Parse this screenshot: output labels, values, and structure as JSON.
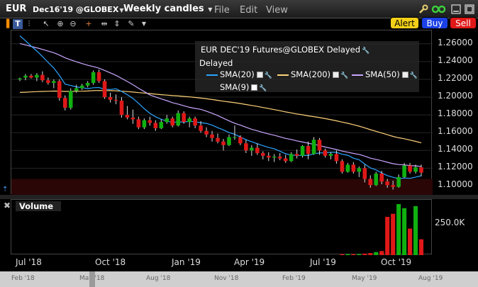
{
  "titlebar": {
    "symbol": "EUR",
    "contract": "Dec16'19 @GLOBEX",
    "timeframe": "Weekly candles",
    "menus": [
      "File",
      "Edit",
      "View"
    ]
  },
  "buttons": {
    "alert": "Alert",
    "buy": "Buy",
    "sell": "Sell"
  },
  "legend": {
    "title": "EUR DEC'19 Futures@GLOBEX Delayed",
    "status": "Delayed",
    "items": [
      {
        "label": "SMA(20)",
        "color": "#2aa5ff",
        "checked": true
      },
      {
        "label": "SMA(200)",
        "color": "#ffd27a",
        "checked": true
      },
      {
        "label": "SMA(50)",
        "color": "#c9a7ff",
        "checked": true
      },
      {
        "label": "SMA(9)",
        "color": "#ffffff",
        "checked": false
      }
    ]
  },
  "volume_panel": {
    "label": "Volume",
    "axis_label": "250.0K"
  },
  "axis": {
    "x_labels": [
      "Jul '18",
      "Oct '18",
      "Jan '19",
      "Apr '19",
      "Jul '19",
      "Oct '19"
    ],
    "scroll_labels": [
      "Feb '18",
      "May '18",
      "Aug '18",
      "Nov '18",
      "Feb '19",
      "May '19",
      "Aug '19"
    ]
  },
  "colors": {
    "up": "#10b010",
    "down": "#e01818",
    "sma20": "#2aa5ff",
    "sma200": "#ffd27a",
    "sma50": "#c9a7ff"
  },
  "chart_data": {
    "type": "candlestick",
    "title": "EUR DEC'19 Futures@GLOBEX Delayed",
    "ylim": [
      1.09,
      1.275
    ],
    "y_ticks": [
      1.26,
      1.24,
      1.22,
      1.2,
      1.18,
      1.16,
      1.14,
      1.12,
      1.1
    ],
    "y_tick_labels": [
      "1.26000",
      "1.24000",
      "1.22000",
      "1.20000",
      "1.18000",
      "1.16000",
      "1.14000",
      "1.12000",
      "1.10000"
    ],
    "candles": [
      [
        1.22,
        1.222,
        1.218,
        1.221
      ],
      [
        1.222,
        1.226,
        1.219,
        1.224
      ],
      [
        1.224,
        1.226,
        1.221,
        1.222
      ],
      [
        1.222,
        1.227,
        1.218,
        1.225
      ],
      [
        1.225,
        1.229,
        1.217,
        1.219
      ],
      [
        1.219,
        1.222,
        1.214,
        1.216
      ],
      [
        1.216,
        1.22,
        1.21,
        1.218
      ],
      [
        1.218,
        1.22,
        1.196,
        1.199
      ],
      [
        1.199,
        1.202,
        1.185,
        1.188
      ],
      [
        1.188,
        1.21,
        1.186,
        1.207
      ],
      [
        1.207,
        1.214,
        1.205,
        1.21
      ],
      [
        1.21,
        1.215,
        1.208,
        1.213
      ],
      [
        1.213,
        1.218,
        1.211,
        1.216
      ],
      [
        1.216,
        1.23,
        1.214,
        1.228
      ],
      [
        1.228,
        1.231,
        1.216,
        1.218
      ],
      [
        1.218,
        1.22,
        1.198,
        1.2
      ],
      [
        1.2,
        1.205,
        1.194,
        1.197
      ],
      [
        1.197,
        1.203,
        1.192,
        1.196
      ],
      [
        1.196,
        1.2,
        1.177,
        1.18
      ],
      [
        1.18,
        1.19,
        1.175,
        1.177
      ],
      [
        1.177,
        1.186,
        1.17,
        1.175
      ],
      [
        1.175,
        1.178,
        1.164,
        1.166
      ],
      [
        1.166,
        1.176,
        1.164,
        1.174
      ],
      [
        1.174,
        1.178,
        1.168,
        1.171
      ],
      [
        1.171,
        1.174,
        1.162,
        1.165
      ],
      [
        1.165,
        1.175,
        1.164,
        1.172
      ],
      [
        1.172,
        1.18,
        1.17,
        1.176
      ],
      [
        1.176,
        1.178,
        1.166,
        1.168
      ],
      [
        1.168,
        1.185,
        1.167,
        1.182
      ],
      [
        1.182,
        1.184,
        1.17,
        1.172
      ],
      [
        1.172,
        1.178,
        1.166,
        1.176
      ],
      [
        1.176,
        1.178,
        1.165,
        1.168
      ],
      [
        1.168,
        1.173,
        1.16,
        1.162
      ],
      [
        1.162,
        1.166,
        1.155,
        1.158
      ],
      [
        1.158,
        1.162,
        1.15,
        1.154
      ],
      [
        1.154,
        1.159,
        1.148,
        1.15
      ],
      [
        1.15,
        1.153,
        1.14,
        1.146
      ],
      [
        1.146,
        1.158,
        1.145,
        1.155
      ],
      [
        1.155,
        1.168,
        1.152,
        1.155
      ],
      [
        1.155,
        1.157,
        1.146,
        1.148
      ],
      [
        1.148,
        1.152,
        1.137,
        1.14
      ],
      [
        1.14,
        1.146,
        1.134,
        1.143
      ],
      [
        1.143,
        1.148,
        1.135,
        1.137
      ],
      [
        1.137,
        1.139,
        1.13,
        1.134
      ],
      [
        1.134,
        1.138,
        1.128,
        1.132
      ],
      [
        1.132,
        1.136,
        1.127,
        1.133
      ],
      [
        1.133,
        1.137,
        1.129,
        1.131
      ],
      [
        1.131,
        1.135,
        1.126,
        1.128
      ],
      [
        1.128,
        1.138,
        1.127,
        1.136
      ],
      [
        1.136,
        1.141,
        1.131,
        1.134
      ],
      [
        1.134,
        1.146,
        1.132,
        1.145
      ],
      [
        1.145,
        1.15,
        1.13,
        1.136
      ],
      [
        1.136,
        1.155,
        1.135,
        1.152
      ],
      [
        1.152,
        1.154,
        1.135,
        1.14
      ],
      [
        1.14,
        1.142,
        1.132,
        1.134
      ],
      [
        1.134,
        1.138,
        1.13,
        1.136
      ],
      [
        1.136,
        1.14,
        1.125,
        1.128
      ],
      [
        1.128,
        1.13,
        1.114,
        1.116
      ],
      [
        1.116,
        1.126,
        1.115,
        1.124
      ],
      [
        1.124,
        1.127,
        1.114,
        1.116
      ],
      [
        1.116,
        1.122,
        1.11,
        1.12
      ],
      [
        1.12,
        1.124,
        1.104,
        1.108
      ],
      [
        1.108,
        1.112,
        1.098,
        1.101
      ],
      [
        1.101,
        1.116,
        1.1,
        1.114
      ],
      [
        1.114,
        1.117,
        1.102,
        1.105
      ],
      [
        1.105,
        1.108,
        1.098,
        1.101
      ],
      [
        1.101,
        1.106,
        1.096,
        1.099
      ],
      [
        1.099,
        1.113,
        1.098,
        1.11
      ],
      [
        1.11,
        1.126,
        1.109,
        1.123
      ],
      [
        1.123,
        1.126,
        1.114,
        1.116
      ],
      [
        1.116,
        1.124,
        1.114,
        1.121
      ],
      [
        1.121,
        1.124,
        1.111,
        1.115
      ]
    ],
    "volume_visible": [
      [
        0,
        0.02
      ],
      [
        1,
        0.02
      ],
      [
        2,
        0.02
      ],
      [
        3,
        0.02
      ],
      [
        4,
        0.03
      ],
      [
        5,
        0.04
      ],
      [
        6,
        0.06
      ],
      [
        7,
        0.08
      ],
      [
        8,
        0.75
      ],
      [
        9,
        0.81
      ],
      [
        10,
        1.0
      ],
      [
        11,
        0.92
      ],
      [
        12,
        0.52
      ],
      [
        13,
        0.96
      ],
      [
        14,
        0.31
      ]
    ],
    "volume_axis_tick": 250000
  }
}
